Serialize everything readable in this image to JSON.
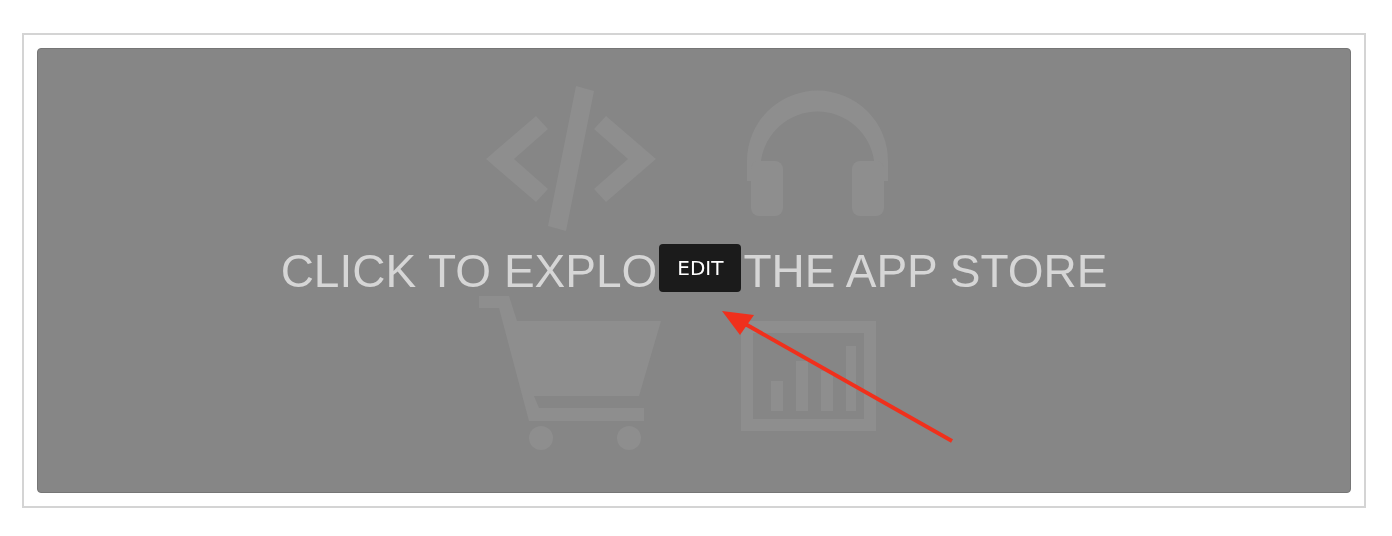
{
  "banner": {
    "headline_before": "CLICK TO EXPLO",
    "badge": "EDIT",
    "headline_after": "THE APP STORE"
  }
}
